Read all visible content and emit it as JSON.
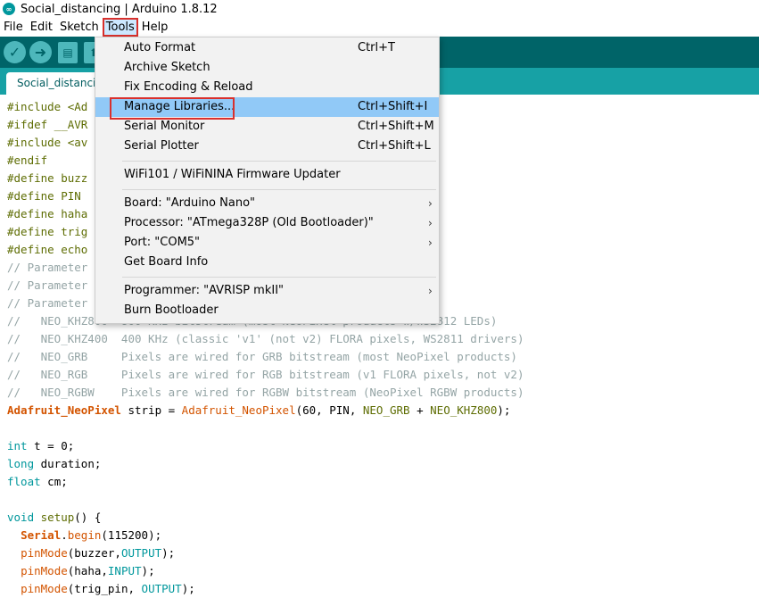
{
  "window": {
    "title": "Social_distancing | Arduino 1.8.12"
  },
  "menubar": {
    "items": [
      "File",
      "Edit",
      "Sketch",
      "Tools",
      "Help"
    ],
    "active": "Tools"
  },
  "tab": {
    "label": "Social_distancing"
  },
  "tools_menu": {
    "items": [
      {
        "label": "Auto Format",
        "shortcut": "Ctrl+T"
      },
      {
        "label": "Archive Sketch",
        "shortcut": ""
      },
      {
        "label": "Fix Encoding & Reload",
        "shortcut": ""
      },
      {
        "label": "Manage Libraries...",
        "shortcut": "Ctrl+Shift+I"
      },
      {
        "label": "Serial Monitor",
        "shortcut": "Ctrl+Shift+M"
      },
      {
        "label": "Serial Plotter",
        "shortcut": "Ctrl+Shift+L"
      },
      {
        "label": "WiFi101 / WiFiNINA Firmware Updater",
        "shortcut": ""
      },
      {
        "label": "Board: \"Arduino Nano\"",
        "submenu": true
      },
      {
        "label": "Processor: \"ATmega328P (Old Bootloader)\"",
        "submenu": true
      },
      {
        "label": "Port: \"COM5\"",
        "submenu": true
      },
      {
        "label": "Get Board Info",
        "shortcut": ""
      },
      {
        "label": "Programmer: \"AVRISP mkII\"",
        "submenu": true
      },
      {
        "label": "Burn Bootloader",
        "shortcut": ""
      }
    ],
    "arrow": "›"
  },
  "code": {
    "l1": "#include <Ad",
    "l2": "#ifdef __AVR",
    "l3": "#include <av",
    "l4": "#endif",
    "l5": "#define buzz",
    "l6": "#define PIN",
    "l7": "#define haha",
    "l8": "#define trig",
    "l9": "#define echo",
    "l10": "// Parameter",
    "l11": "// Parameter",
    "l12": "// Parameter",
    "l13": "//   NEO_KHZ800  800 KHz bitstream (most NeoPixel products w/WS2812 LEDs)",
    "l14": "//   NEO_KHZ400  400 KHz (classic 'v1' (not v2) FLORA pixels, WS2811 drivers)",
    "l15": "//   NEO_GRB     Pixels are wired for GRB bitstream (most NeoPixel products)",
    "l16": "//   NEO_RGB     Pixels are wired for RGB bitstream (v1 FLORA pixels, not v2)",
    "l17": "//   NEO_RGBW    Pixels are wired for RGBW bitstream (NeoPixel RGBW products)",
    "l18": {
      "t1": "Adafruit_NeoPixel",
      "t2": " strip = ",
      "t3": "Adafruit_NeoPixel",
      "t4": "(60, PIN, ",
      "t5": "NEO_GRB",
      "t6": " + ",
      "t7": "NEO_KHZ800",
      "t8": ");"
    },
    "l20": {
      "t1": "int",
      "t2": " t = 0;"
    },
    "l21": {
      "t1": "long",
      "t2": " duration;"
    },
    "l22": {
      "t1": "float",
      "t2": " cm;"
    },
    "l24": {
      "t1": "void",
      "t2": " ",
      "t3": "setup",
      "t4": "() {"
    },
    "l25": {
      "t0": "  ",
      "t1": "Serial",
      "t2": ".",
      "t3": "begin",
      "t4": "(115200);"
    },
    "l26": {
      "t0": "  ",
      "t1": "pinMode",
      "t2": "(buzzer,",
      "t3": "OUTPUT",
      "t4": ");"
    },
    "l27": {
      "t0": "  ",
      "t1": "pinMode",
      "t2": "(haha,",
      "t3": "INPUT",
      "t4": ");"
    },
    "l28": {
      "t0": "  ",
      "t1": "pinMode",
      "t2": "(trig_pin, ",
      "t3": "OUTPUT",
      "t4": ");"
    }
  },
  "colors": {
    "toolbar": "#006468",
    "tabbar": "#17a1a5",
    "highlight": "#91c9f7",
    "annotation": "#d9302c"
  }
}
